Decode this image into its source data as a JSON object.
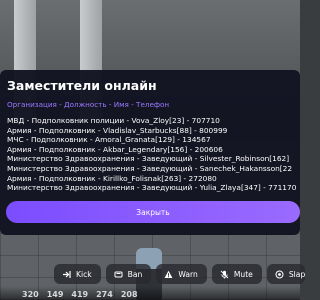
{
  "panel": {
    "title": "Заместители онлайн",
    "subtitle": "Организация - Должность - Имя - Телефон",
    "rows": [
      "МВД - Подполковник полиции - Vova_Zloy[23] - 707710",
      "Армия - Подполковник - Vladislav_Starbucks[88] - 800999",
      "МЧС - Подполковник - Amoral_Granata[129] - 134567",
      "Армия - Подполковник - Akbar_Legendary[156] - 200606",
      "Министерство Здравоохранения - Заведующий - Silvester_Robinson[162]",
      "Министерство Здравоохранения - Заведующий - Sanechek_Hakansson[22",
      "Армия - Подполковник - Kirillko_Folisnak[263] - 272080",
      "Министерство Здравоохранения - Заведующий - Yulia_Zlaya[347] - 771170"
    ],
    "close_label": "Закрыть"
  },
  "actions": [
    {
      "label": "Kick",
      "icon": "kick-icon"
    },
    {
      "label": "Ban",
      "icon": "ban-icon"
    },
    {
      "label": "Warn",
      "icon": "warning-icon"
    },
    {
      "label": "Mute",
      "icon": "mute-icon"
    },
    {
      "label": "Slap",
      "icon": "slap-icon"
    }
  ],
  "stats": [
    "320",
    "149",
    "419",
    "274",
    "208"
  ],
  "colors": {
    "panel_bg": "#131422",
    "accent": "#8b5cff",
    "subtitle": "#9a78ff"
  }
}
